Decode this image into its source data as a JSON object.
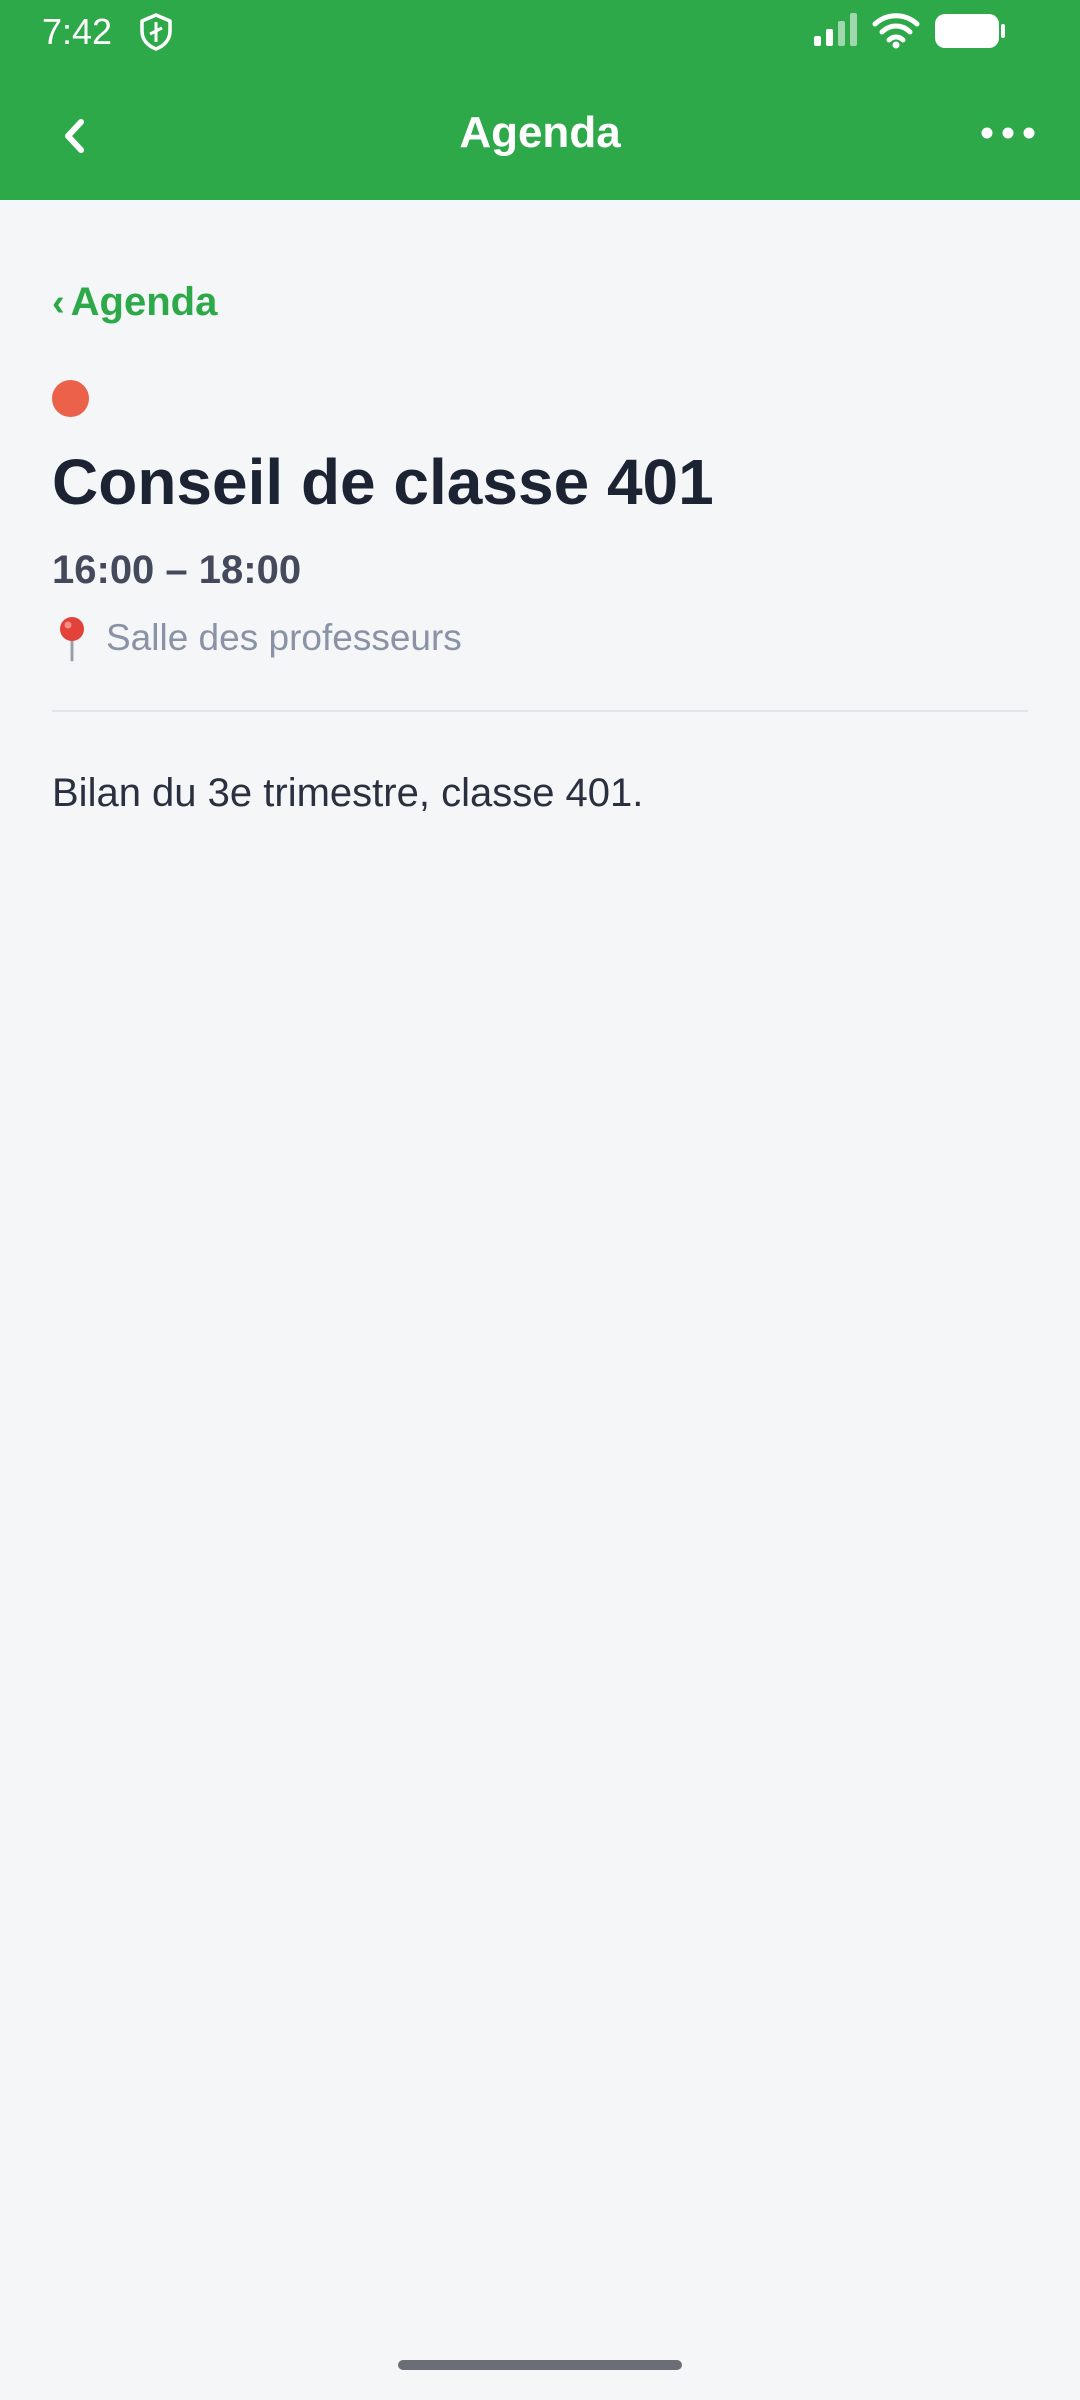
{
  "status_bar": {
    "time": "7:42",
    "icons": [
      "shield-icon",
      "signal-icon",
      "wifi-icon",
      "battery-icon"
    ]
  },
  "app_bar": {
    "title": "Agenda",
    "back_icon": "chevron-left-icon",
    "menu_icon": "more-horizontal-icon"
  },
  "breadcrumb": {
    "chevron": "‹",
    "label": "Agenda"
  },
  "event": {
    "color": "#ec6149",
    "title": "Conseil de classe 401",
    "time_range": "16:00 – 18:00",
    "location_icon": "map-pin-icon",
    "location": "Salle des professeurs",
    "description": "Bilan du 3e trimestre, classe 401."
  },
  "colors": {
    "primary": "#2ea94a",
    "background": "#f5f6f8",
    "event_dot": "#ec6149"
  }
}
